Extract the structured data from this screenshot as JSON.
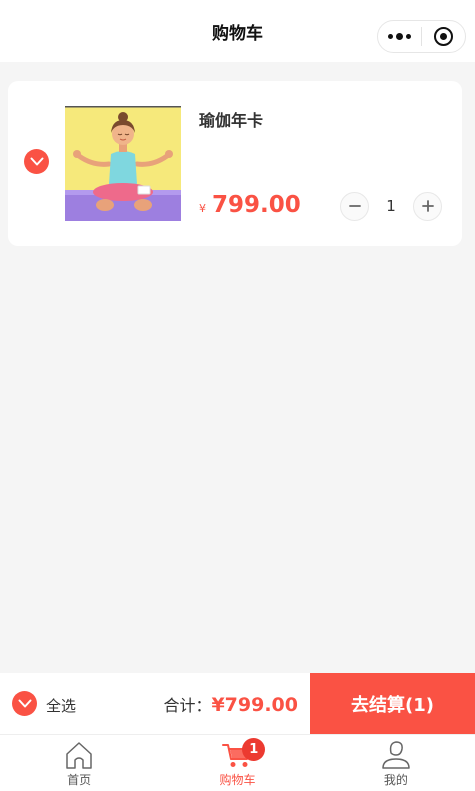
{
  "navbar": {
    "title": "购物车",
    "more_icon": "more-dots-icon",
    "close_icon": "target-circle-icon"
  },
  "cart": {
    "items": [
      {
        "name": "瑜伽年卡",
        "currency": "¥",
        "price": "799.00",
        "quantity": "1",
        "checked": true,
        "image_icon": "yoga-girl-illustration"
      }
    ]
  },
  "settle": {
    "select_all_label": "全选",
    "total_label": "合计：",
    "total_amount": "¥799.00",
    "checkout_label": "去结算(1)"
  },
  "tabbar": {
    "tabs": [
      {
        "label": "首页",
        "icon": "home-icon",
        "active": false
      },
      {
        "label": "购物车",
        "icon": "cart-icon",
        "active": true,
        "badge": "1"
      },
      {
        "label": "我的",
        "icon": "profile-icon",
        "active": false
      }
    ]
  },
  "colors": {
    "accent": "#fa5244",
    "badge": "#ec3a30",
    "background": "#f5f5f5"
  }
}
